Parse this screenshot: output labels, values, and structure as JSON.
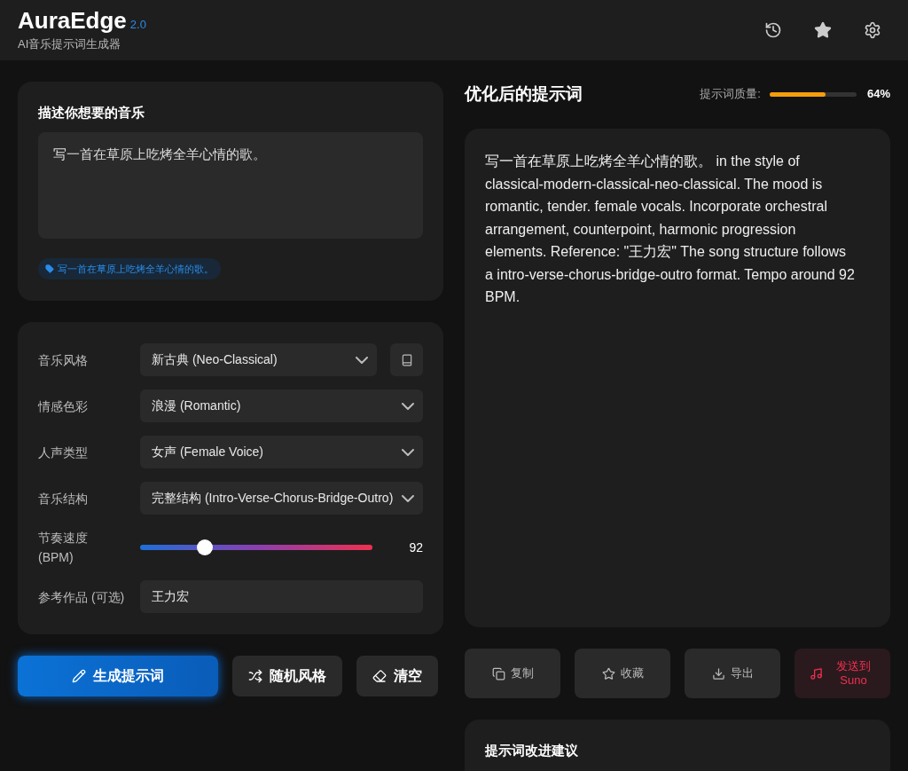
{
  "header": {
    "title": "AuraEdge",
    "version": "2.0",
    "subtitle": "AI音乐提示词生成器"
  },
  "describe": {
    "title": "描述你想要的音乐",
    "value": "写一首在草原上吃烤全羊心情的歌。",
    "tags": [
      "写一首在草原上吃烤全羊心情的歌。"
    ]
  },
  "settings": [
    {
      "kind": "select",
      "label": "音乐风格",
      "value": "新古典 (Neo-Classical)",
      "library": true
    },
    {
      "kind": "select",
      "label": "情感色彩",
      "value": "浪漫 (Romantic)",
      "library": false
    },
    {
      "kind": "select",
      "label": "人声类型",
      "value": "女声 (Female Voice)",
      "library": false
    },
    {
      "kind": "select",
      "label": "音乐结构",
      "value": "完整结构 (Intro-Verse-Chorus-Bridge-Outro)",
      "library": false
    },
    {
      "kind": "slider",
      "label": "节奏速度 (BPM)",
      "level": 0.28,
      "reading": "92"
    },
    {
      "kind": "input",
      "label": "参考作品 (可选)",
      "value": "王力宏"
    }
  ],
  "actions": [
    {
      "kind": "primary",
      "label": "生成提示词"
    },
    {
      "kind": "shuffle",
      "label": "随机风格"
    },
    {
      "kind": "clear",
      "label": "清空"
    }
  ],
  "result": {
    "title": "优化后的提示词",
    "quality_label": "提示词质量:",
    "quality": {
      "level": 0.64,
      "reading": "64%"
    },
    "text": "写一首在草原上吃烤全羊心情的歌。 in the style of classical-modern-classical-neo-classical. The mood is romantic, tender. female vocals. Incorporate orchestral arrangement, counterpoint, harmonic progression elements. Reference: \"王力宏\" The song structure follows a intro-verse-chorus-bridge-outro format. Tempo around 92 BPM."
  },
  "result_actions": [
    {
      "kind": "copy",
      "label": "复制"
    },
    {
      "kind": "favorite",
      "label": "收藏"
    },
    {
      "kind": "export",
      "label": "导出"
    },
    {
      "kind": "suno",
      "label": "发送到 Suno"
    }
  ],
  "suggestions": {
    "title": "提示词改进建议"
  }
}
